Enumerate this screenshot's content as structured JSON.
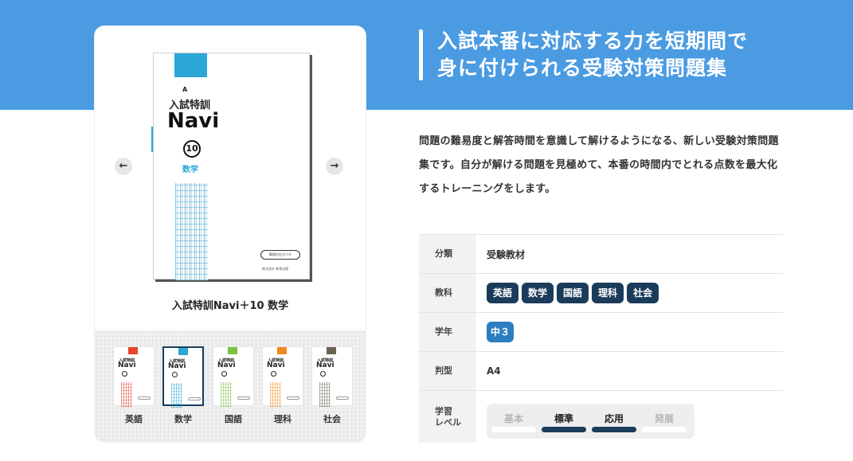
{
  "hero": {
    "title_line1": "入試本番に対応する力を短期間で",
    "title_line2": "身に付けられる受験対策問題集"
  },
  "product": {
    "title": "入試特訓Navi＋10 数学",
    "cover": {
      "series": "入試特訓",
      "name": "Navi",
      "number": "10",
      "subject": "数学",
      "badge": "解説の仕方つき",
      "publisher": "株式会社 教育出版"
    }
  },
  "nav": {
    "prev_icon": "arrow-left-icon",
    "next_icon": "arrow-right-icon",
    "prev_glyph": "←",
    "next_glyph": "→"
  },
  "thumbnails": [
    {
      "label": "英語",
      "color": "#e8442f"
    },
    {
      "label": "数学",
      "color": "#2aa7d6"
    },
    {
      "label": "国語",
      "color": "#7cc142"
    },
    {
      "label": "理科",
      "color": "#f18a1e"
    },
    {
      "label": "社会",
      "color": "#6b6452"
    }
  ],
  "description": "問題の難易度と解答時間を意識して解けるようになる、新しい受験対策問題集です。自分が解ける問題を見極めて、本番の時間内でとれる点数を最大化するトレーニングをします。",
  "specs": {
    "category_label": "分類",
    "category_value": "受験教材",
    "subject_label": "教科",
    "subjects": [
      "英語",
      "数学",
      "国語",
      "理科",
      "社会"
    ],
    "grade_label": "学年",
    "grade_value": "中３",
    "format_label": "判型",
    "format_value": "A4",
    "level_label": "学習\nレベル",
    "levels": [
      {
        "label": "基本",
        "active": false
      },
      {
        "label": "標準",
        "active": true
      },
      {
        "label": "応用",
        "active": true
      },
      {
        "label": "発展",
        "active": false
      }
    ]
  },
  "colors": {
    "accent": "#4a9be2",
    "navy": "#1a3c5a",
    "grade_pill": "#2d7ec0"
  }
}
